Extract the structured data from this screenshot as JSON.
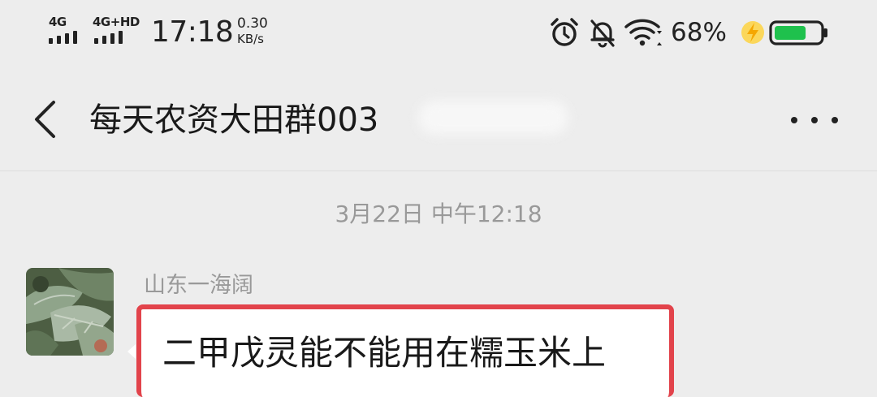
{
  "status_bar": {
    "network1": "4G",
    "network2": "4G+HD",
    "time": "17:18",
    "speed_value": "0.30",
    "speed_unit": "KB/s",
    "battery": "68%",
    "battery_level": 0.68,
    "icons": [
      "alarm-icon",
      "mute-icon",
      "wifi-icon",
      "charging-icon",
      "battery-icon"
    ]
  },
  "header": {
    "title": "每天农资大田群003"
  },
  "chat": {
    "timestamp": "3月22日 中午12:18",
    "messages": [
      {
        "sender": "山东一海阔",
        "text": "二甲戊灵能不能用在糯玉米上"
      }
    ]
  },
  "colors": {
    "background": "#ededed",
    "bubble": "#ffffff",
    "highlight_border": "#e2434b",
    "battery_green": "#1fc14d",
    "charging_yellow": "#f5b800"
  }
}
